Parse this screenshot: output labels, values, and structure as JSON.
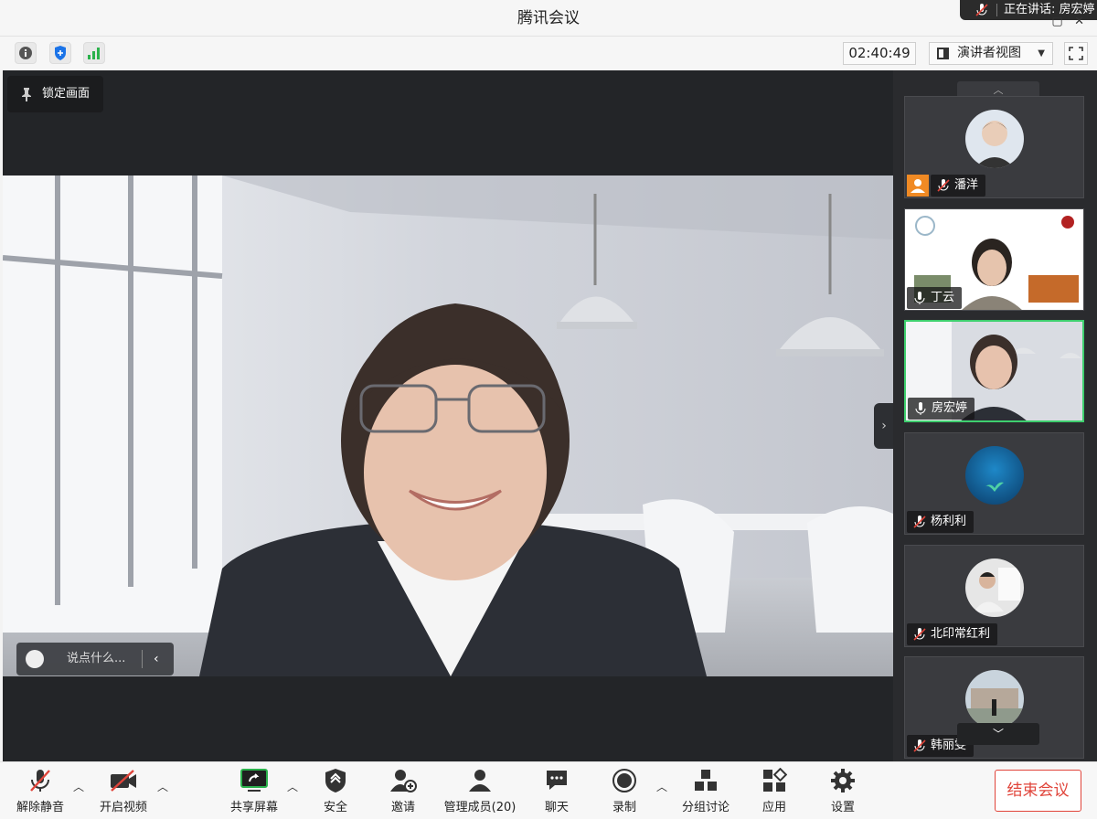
{
  "window": {
    "title": "腾讯会议",
    "speaking_text": "正在讲话: 房宏婷"
  },
  "toolbar": {
    "timer": "02:40:49",
    "view_mode": "演讲者视图"
  },
  "stage": {
    "lock_label": "锁定画面",
    "chat_placeholder": "说点什么..."
  },
  "participants": [
    {
      "name": "潘洋",
      "muted": true,
      "host": true
    },
    {
      "name": "丁云",
      "muted": false,
      "host": false
    },
    {
      "name": "房宏婷",
      "muted": false,
      "host": false,
      "active": true
    },
    {
      "name": "杨利利",
      "muted": true,
      "host": false
    },
    {
      "name": "北印常红利",
      "muted": true,
      "host": false
    },
    {
      "name": "韩丽雯",
      "muted": true,
      "host": false
    }
  ],
  "bottombar": {
    "unmute": "解除静音",
    "start_video": "开启视频",
    "share_screen": "共享屏幕",
    "security": "安全",
    "invite": "邀请",
    "manage_members": "管理成员(20)",
    "chat": "聊天",
    "record": "录制",
    "breakout": "分组讨论",
    "apps": "应用",
    "settings": "设置",
    "end_meeting": "结束会议"
  },
  "colors": {
    "accent_green": "#3ecf6e",
    "end_red": "#e0443a",
    "host_orange": "#f08a24",
    "share_green": "#2bb24c"
  }
}
